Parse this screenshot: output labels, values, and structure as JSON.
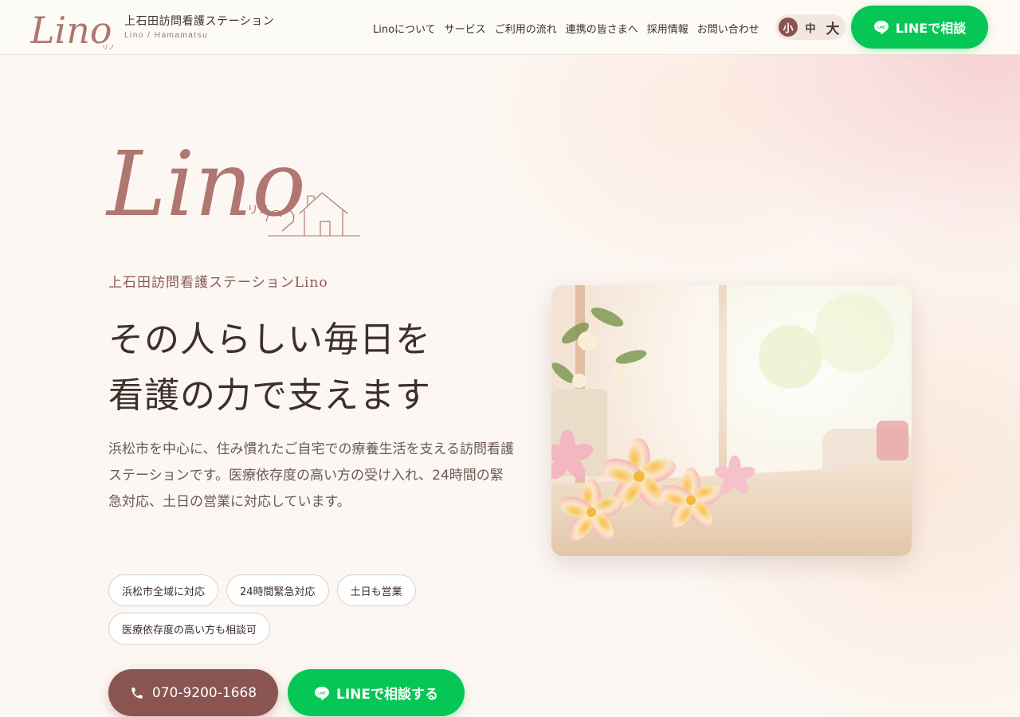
{
  "brand": {
    "logo_text": "Lino",
    "logo_ruby": "リノ",
    "name": "上石田訪問看護ステーション",
    "sub": "Lino / Hamamatsu"
  },
  "nav": {
    "items": [
      "Linoについて",
      "サービス",
      "ご利用の流れ",
      "連携の皆さまへ",
      "採用情報",
      "お問い合わせ"
    ]
  },
  "font_size": {
    "options": [
      "小",
      "中",
      "大"
    ],
    "selected": "小"
  },
  "header_line_button": {
    "label": "LINEで相談",
    "icon_text": "LINE"
  },
  "hero": {
    "logo_text": "Lino",
    "logo_ruby": "リノ",
    "eyebrow": "上石田訪問看護ステーションLino",
    "title_line1": "その人らしい毎日を",
    "title_line2": "看護の力で支えます",
    "description": "浜松市を中心に、住み慣れたご自宅での療養生活を支える訪問看護ステーションです。医療依存度の高い方の受け入れ、24時間の緊急対応、土日の営業に対応しています。",
    "tags": [
      "浜松市全域に対応",
      "24時間緊急対応",
      "土日も営業",
      "医療依存度の高い方も相談可"
    ],
    "phone_label": "070-9200-1668",
    "line_label": "LINEで相談する"
  },
  "colors": {
    "accent": "#8a5450",
    "line_green": "#06c755",
    "logo": "#b07670",
    "text": "#3e2f2b"
  }
}
